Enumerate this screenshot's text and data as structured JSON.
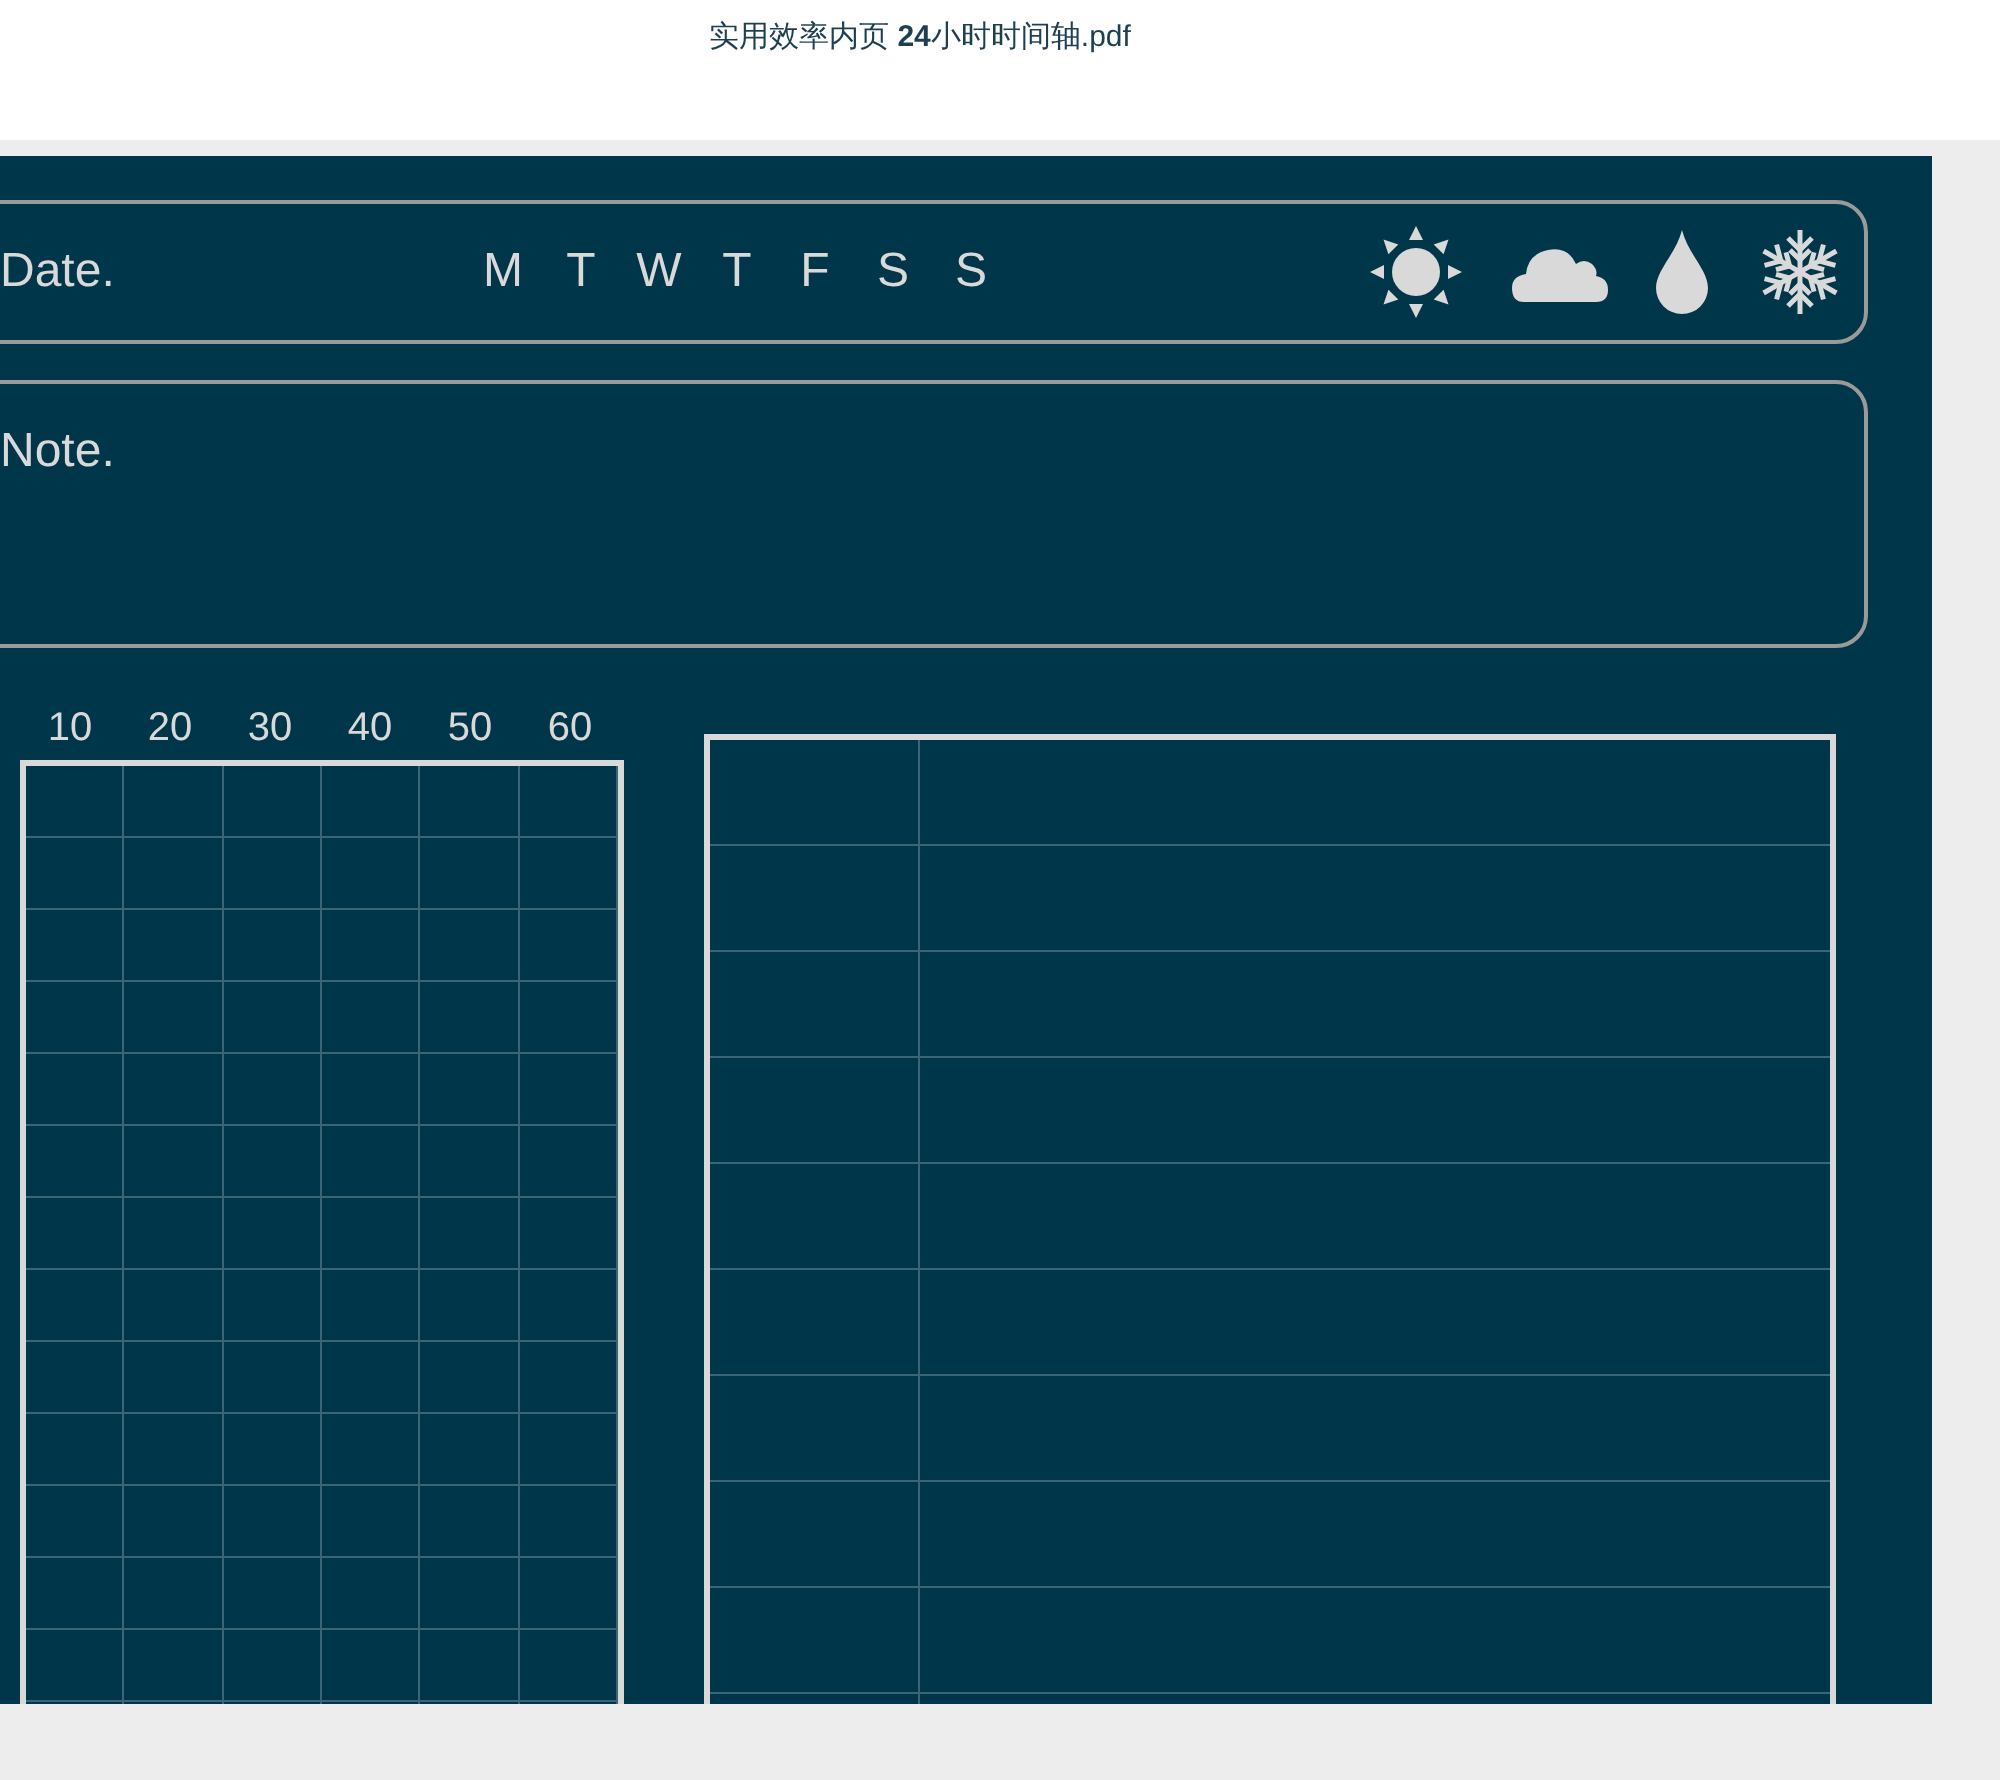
{
  "window": {
    "title": "实用效率内页 **24**小时时间轴.pdf"
  },
  "date_bar": {
    "label": "Date.",
    "weekdays": [
      "M",
      "T",
      "W",
      "T",
      "F",
      "S",
      "S"
    ]
  },
  "note": {
    "label": "Note."
  },
  "minute_grid": {
    "column_labels": [
      "10",
      "20",
      "30",
      "40",
      "50",
      "60"
    ]
  }
}
